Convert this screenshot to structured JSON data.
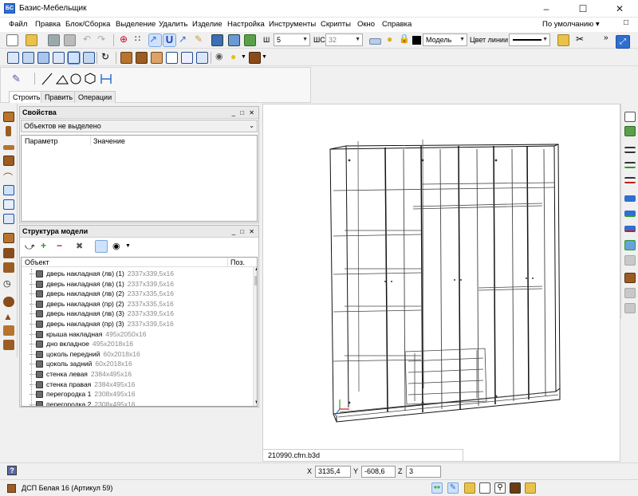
{
  "window": {
    "title": "Базис-Мебельщик"
  },
  "menu": [
    "Файл",
    "Правка",
    "Блок/Сборка",
    "Выделение",
    "Удалить",
    "Изделие",
    "Настройка",
    "Инструменты",
    "Скрипты",
    "Окно",
    "Справка"
  ],
  "preset": "По умолчанию",
  "toolbar": {
    "w_label": "Ш",
    "w_value": "5",
    "ws_label": "ШС",
    "ws_value": "32",
    "layer_value": "Модель",
    "line_color_label": "Цвет линии"
  },
  "ribbon": {
    "tabs": [
      "Строить",
      "Править",
      "Операции"
    ]
  },
  "properties": {
    "title": "Свойства",
    "selection": "Объектов не выделено",
    "col_param": "Параметр",
    "col_value": "Значение"
  },
  "structure": {
    "title": "Структура модели",
    "col_object": "Объект",
    "col_pos": "Поз.",
    "items": [
      {
        "name": "дверь накладная (лв) (1)",
        "dim": "2337x339,5x16"
      },
      {
        "name": "дверь накладная (лв) (1)",
        "dim": "2337x339,5x16"
      },
      {
        "name": "дверь накладная (лв) (2)",
        "dim": "2337x335,5x16"
      },
      {
        "name": "дверь накладная (пр) (2)",
        "dim": "2337x335,5x16"
      },
      {
        "name": "дверь накладная (лв) (3)",
        "dim": "2337x339,5x16"
      },
      {
        "name": "дверь накладная (пр) (3)",
        "dim": "2337x339,5x16"
      },
      {
        "name": "крыша накладная",
        "dim": "495x2050x16"
      },
      {
        "name": "дно вкладное",
        "dim": "495x2018x16"
      },
      {
        "name": "цоколь передний",
        "dim": "60x2018x16"
      },
      {
        "name": "цоколь задний",
        "dim": "60x2018x16"
      },
      {
        "name": "стенка левая",
        "dim": "2384x495x16"
      },
      {
        "name": "стенка правая",
        "dim": "2384x495x16"
      },
      {
        "name": "перегородка 1",
        "dim": "2308x495x16"
      },
      {
        "name": "перегородка 2",
        "dim": "2308x495x16"
      }
    ]
  },
  "viewport": {
    "filename": "210990.cfrn.b3d"
  },
  "coords": {
    "x_label": "X",
    "x": "3135,4",
    "y_label": "Y",
    "y": "-608,6",
    "z_label": "Z",
    "z": "3"
  },
  "status": {
    "material": "ДСП Белая 16 (Артикул 59)"
  },
  "colors": {
    "accent": "#2e6fd1",
    "selection": "#cfe2fb"
  }
}
